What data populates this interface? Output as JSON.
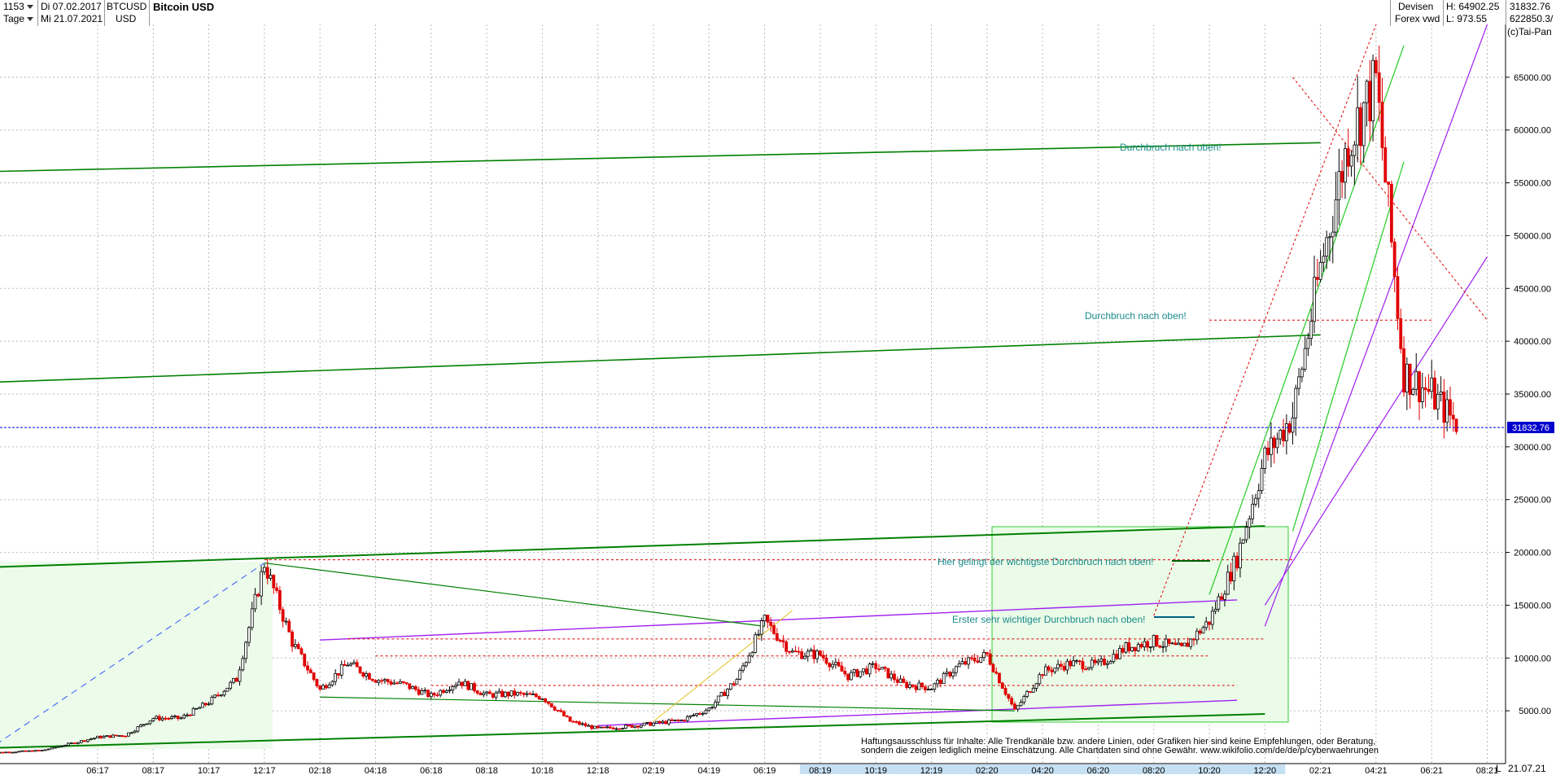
{
  "header": {
    "count": "1153",
    "period": "Tage",
    "date_from": "Di 07.02.2017",
    "date_to": "Mi 21.07.2021",
    "symbol": "BTCUSD",
    "currency": "USD",
    "title": "Bitcoin USD",
    "market_1": "Devisen",
    "market_2": "Forex vwd",
    "high": "H: 64902.25",
    "low": "L: 973.55",
    "last": "31832.76",
    "volume": "622850.3/",
    "copyright": "(c)Tai-Pan"
  },
  "annotations": {
    "breakout_top": "Durchbruch nach oben!",
    "breakout_mid": "Durchbruch nach oben!",
    "breakout_important": "Hier gelingt der wichtigste Durchbruch nach oben!",
    "breakout_first": "Erster sehr wichtiger Durchbruch nach oben!"
  },
  "footer": {
    "line1": "Haftungsausschluss für Inhalte: Alle Trendkanäle bzw. andere Linien, oder Grafiken hier sind keine Empfehlungen, oder Beratung,",
    "line2": "sondern die zeigen lediglich meine  Einschätzung. Alle Chartdaten sind ohne Gewähr.  www.wikifolio.com/de/de/p/cyberwaehrungen",
    "end_date": "21.07.21",
    "scale_mode": "L"
  },
  "colors": {
    "candle_up": "#000000",
    "candle_down": "#e00000",
    "grid": "#bbbbbb",
    "price_line": "#0000ff",
    "trend_green": "#008000",
    "trend_purple": "#a020f0"
  },
  "chart_data": {
    "type": "candlestick",
    "title": "Bitcoin USD",
    "ylim": [
      0,
      70000
    ],
    "y_ticks": [
      5000,
      10000,
      15000,
      20000,
      25000,
      30000,
      35000,
      40000,
      45000,
      50000,
      55000,
      60000,
      65000
    ],
    "y_tick_labels": [
      "5000.00",
      "10000.00",
      "15000.00",
      "20000.00",
      "25000.00",
      "30000.00",
      "35000.00",
      "40000.00",
      "45000.00",
      "50000.00",
      "55000.00",
      "60000.00",
      "65000.00"
    ],
    "x_tick_labels": [
      "06:17",
      "08:17",
      "10:17",
      "12:17",
      "02:18",
      "04:18",
      "06:18",
      "08:18",
      "10:18",
      "12:18",
      "02:19",
      "04:19",
      "06:19",
      "08:19",
      "10:19",
      "12:19",
      "02:20",
      "04:20",
      "06:20",
      "08:20",
      "10:20",
      "12:20",
      "02:21",
      "04:21",
      "06:21",
      "08:21"
    ],
    "last_price": 31832.76,
    "last_price_label": "31832.76",
    "close_path": [
      [
        "2017-02",
        1000
      ],
      [
        "2017-04",
        1250
      ],
      [
        "2017-06",
        2500
      ],
      [
        "2017-07",
        2700
      ],
      [
        "2017-08",
        4300
      ],
      [
        "2017-09",
        4300
      ],
      [
        "2017-10",
        5800
      ],
      [
        "2017-11",
        8000
      ],
      [
        "2017-12",
        19000
      ],
      [
        "2018-01",
        11500
      ],
      [
        "2018-02",
        7000
      ],
      [
        "2018-03",
        9500
      ],
      [
        "2018-04",
        8000
      ],
      [
        "2018-05",
        7500
      ],
      [
        "2018-06",
        6400
      ],
      [
        "2018-07",
        7800
      ],
      [
        "2018-08",
        6500
      ],
      [
        "2018-09",
        6600
      ],
      [
        "2018-10",
        6300
      ],
      [
        "2018-11",
        4000
      ],
      [
        "2018-12",
        3300
      ],
      [
        "2019-01",
        3500
      ],
      [
        "2019-02",
        3800
      ],
      [
        "2019-03",
        4100
      ],
      [
        "2019-04",
        5200
      ],
      [
        "2019-05",
        8000
      ],
      [
        "2019-06",
        13500
      ],
      [
        "2019-07",
        10500
      ],
      [
        "2019-08",
        10300
      ],
      [
        "2019-09",
        8300
      ],
      [
        "2019-10",
        9200
      ],
      [
        "2019-11",
        7500
      ],
      [
        "2019-12",
        7200
      ],
      [
        "2020-01",
        9300
      ],
      [
        "2020-02",
        10300
      ],
      [
        "2020-03",
        5000
      ],
      [
        "2020-04",
        8700
      ],
      [
        "2020-05",
        9500
      ],
      [
        "2020-06",
        9300
      ],
      [
        "2020-07",
        11000
      ],
      [
        "2020-08",
        11600
      ],
      [
        "2020-09",
        10800
      ],
      [
        "2020-10",
        13500
      ],
      [
        "2020-11",
        19500
      ],
      [
        "2020-12",
        29000
      ],
      [
        "2021-01",
        33000
      ],
      [
        "2021-02",
        47000
      ],
      [
        "2021-03",
        59000
      ],
      [
        "2021-04",
        64500
      ],
      [
        "2021-05",
        37000
      ],
      [
        "2021-06",
        35000
      ],
      [
        "2021-07",
        31832
      ]
    ]
  }
}
